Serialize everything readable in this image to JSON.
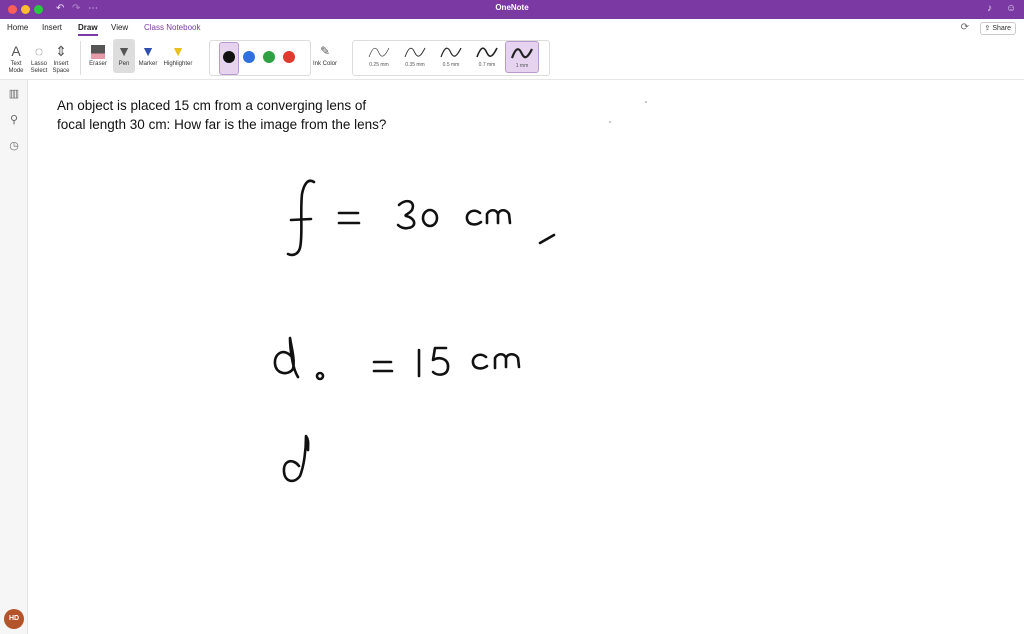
{
  "window": {
    "title": "OneNote"
  },
  "ribbon": {
    "tabs": [
      {
        "label": "Home"
      },
      {
        "label": "Insert"
      },
      {
        "label": "Draw"
      },
      {
        "label": "View"
      },
      {
        "label": "Class Notebook"
      }
    ],
    "active_tab": "Draw",
    "share_label": "Share"
  },
  "toolbar": {
    "text_mode": "Text Mode",
    "lasso_select": "Lasso Select",
    "insert_space": "Insert Space",
    "eraser": "Eraser",
    "pen": "Pen",
    "marker": "Marker",
    "highlighter": "Highlighter",
    "ink_color": "Ink Color",
    "colors": [
      "#111111",
      "#2f6fe0",
      "#2fa043",
      "#e03a2f"
    ],
    "selected_color": "#111111",
    "thicknesses": [
      "0.25 mm",
      "0.35 mm",
      "0.5 mm",
      "0.7 mm",
      "1 mm"
    ],
    "selected_thickness": "1 mm"
  },
  "user": {
    "initials": "HD",
    "avatar_color": "#b4542a"
  },
  "page": {
    "question": "An object is placed 15 cm from a converging lens of focal length 30 cm: How far is the image from the lens?",
    "handwriting": [
      "f = 30 cm ,",
      "d₀ = 15 cm",
      "d"
    ]
  },
  "colors": {
    "accent": "#7b3aa3"
  }
}
